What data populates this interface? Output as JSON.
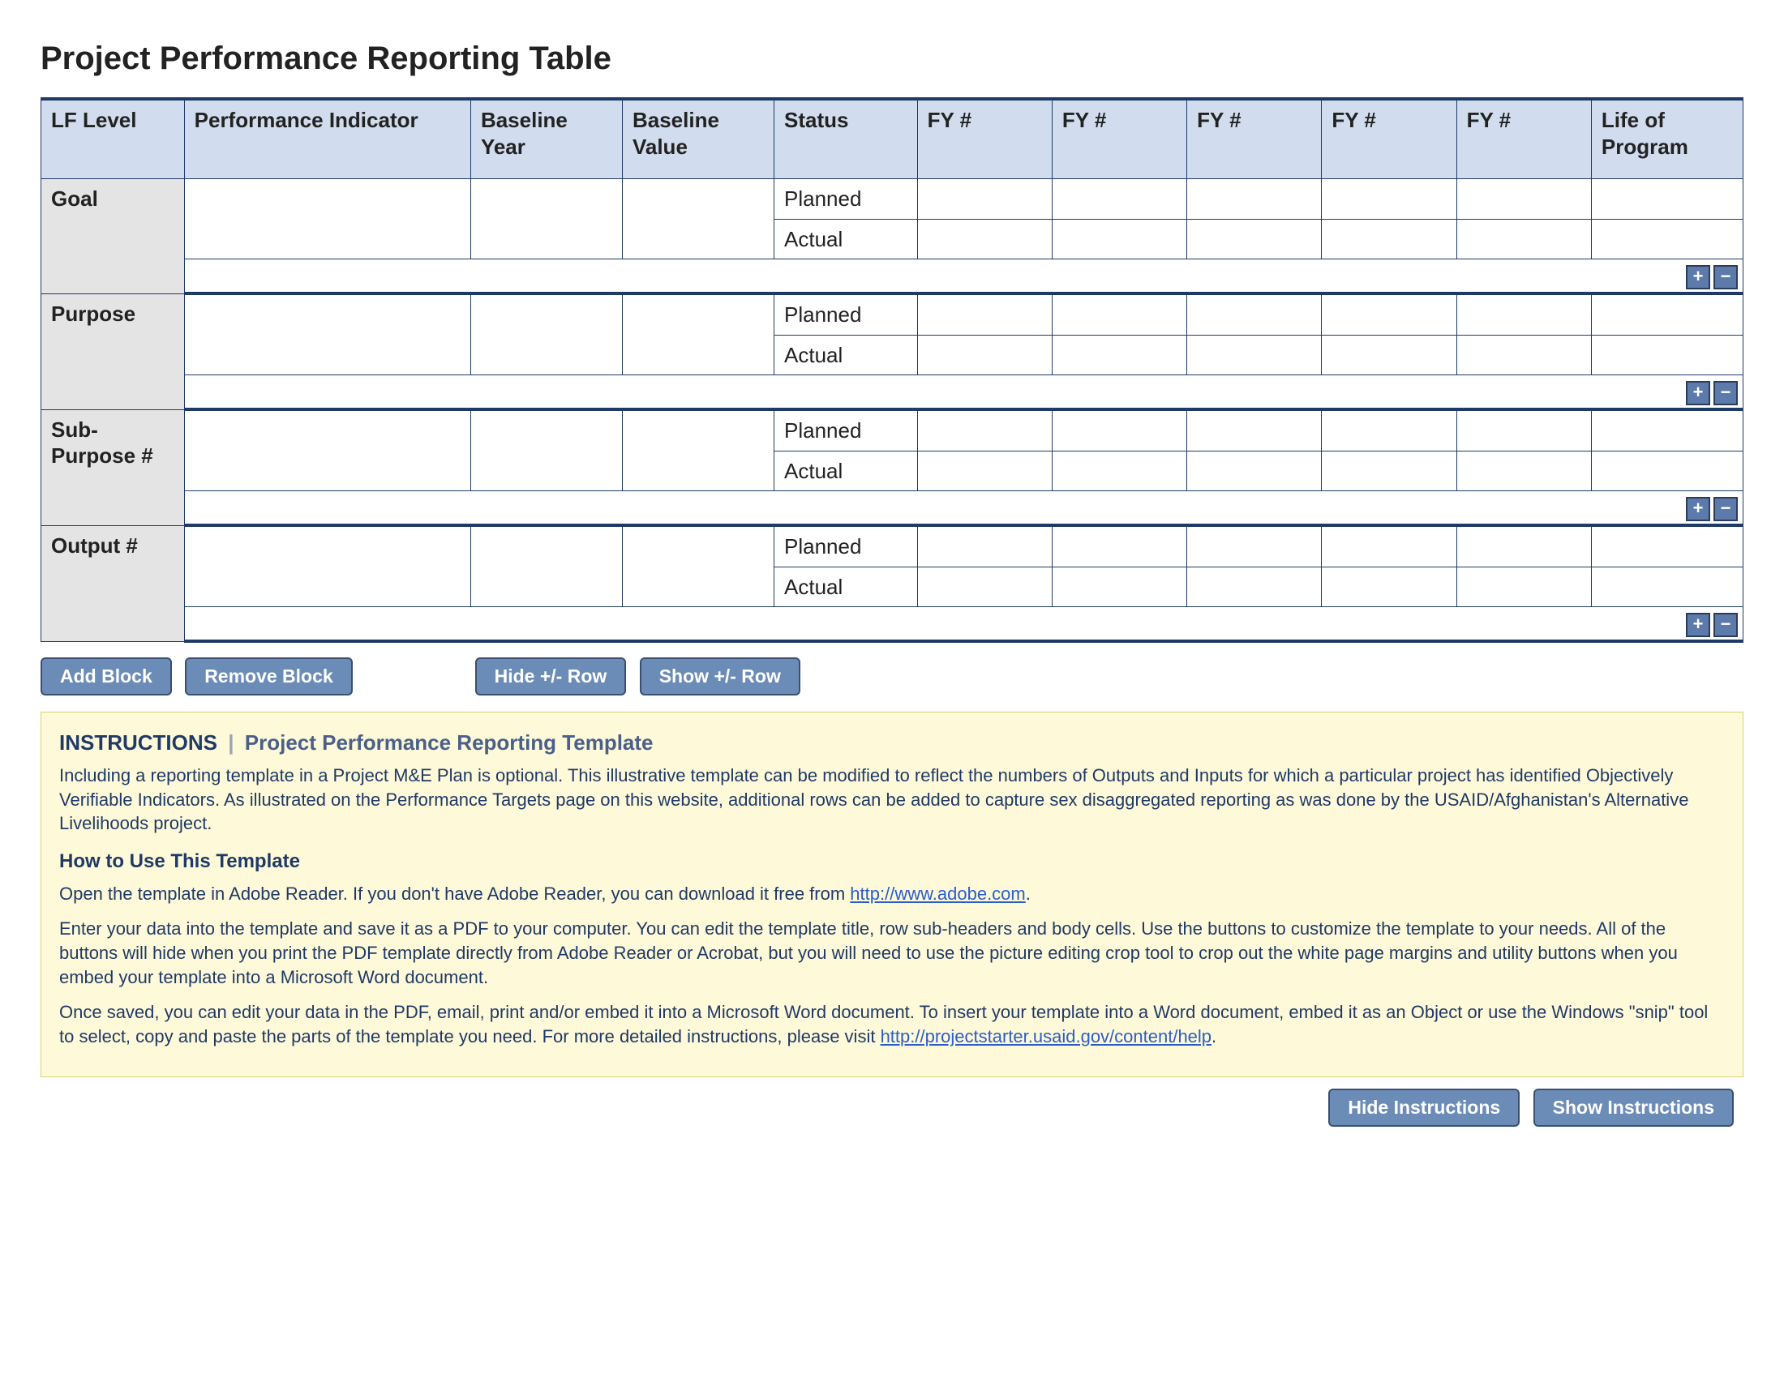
{
  "title": "Project Performance Reporting Table",
  "headers": {
    "lf": "LF Level",
    "pi": "Performance Indicator",
    "by": "Baseline Year",
    "bv": "Baseline Value",
    "st": "Status",
    "fy": "FY #",
    "life": "Life of Program"
  },
  "status": {
    "planned": "Planned",
    "actual": "Actual"
  },
  "blocks": [
    {
      "lf": "Goal"
    },
    {
      "lf": "Purpose"
    },
    {
      "lf": "Sub-Purpose #"
    },
    {
      "lf": "Output #"
    }
  ],
  "pm": {
    "plus": "+",
    "minus": "−"
  },
  "buttons": {
    "add": "Add Block",
    "remove": "Remove Block",
    "hide": "Hide +/- Row",
    "show": "Show +/- Row",
    "hideInstr": "Hide Instructions",
    "showInstr": "Show Instructions"
  },
  "instr": {
    "title": "INSTRUCTIONS",
    "subtitle": "Project Performance Reporting Template",
    "p1": "Including a reporting template in a Project M&E Plan is optional. This illustrative template can be modified to reflect the numbers of Outputs and Inputs for which a particular project has identified Objectively Verifiable Indicators. As illustrated on the Performance Targets page on this website, additional rows can be added to capture sex disaggregated reporting as was done by the USAID/Afghanistan's Alternative Livelihoods project.",
    "howTitle": "How to Use This Template",
    "p2a": "Open the template in Adobe Reader. If you don't have Adobe Reader, you can download it free from ",
    "link1": "http://www.adobe.com",
    "p2b": ".",
    "p3": "Enter your data into the template and save it as a PDF to your computer. You can edit the template title, row sub-headers and body cells. Use the buttons to customize the template to your needs. All of the buttons will hide when you print the PDF template directly from Adobe Reader or Acrobat, but you will need to use the picture editing crop tool to crop out the white page margins and utility buttons when you embed your template into a Microsoft Word document.",
    "p4a": "Once saved, you can edit your data in the PDF, email, print and/or embed it into a Microsoft Word document. To insert your template into a Word document, embed it as an Object or use the Windows \"snip\" tool to select, copy and paste the parts of the template you need. For more detailed instructions, please visit ",
    "link2": "http://projectstarter.usaid.gov/content/help",
    "p4b": "."
  }
}
